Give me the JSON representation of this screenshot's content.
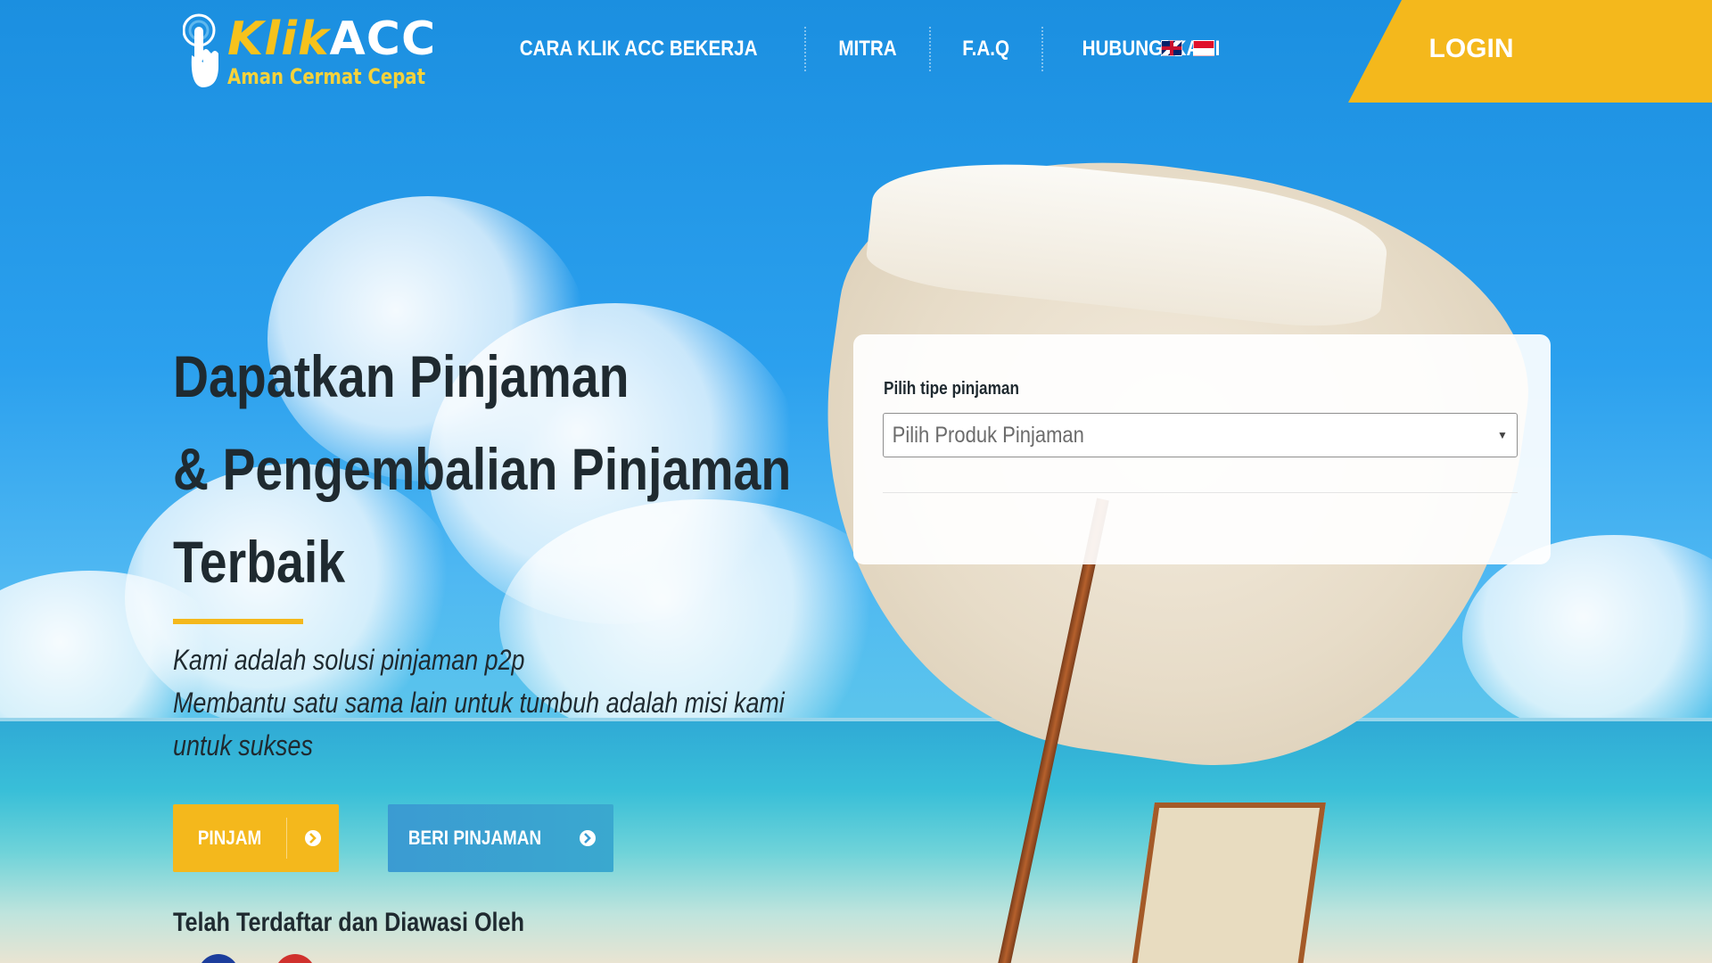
{
  "header": {
    "logo": {
      "title_part1": "Klik",
      "title_part2": "ACC",
      "tagline": "Aman Cermat Cepat"
    },
    "nav": [
      {
        "label": "CARA KLIK ACC BEKERJA"
      },
      {
        "label": "MITRA"
      },
      {
        "label": "F.A.Q"
      },
      {
        "label": "HUBUNGI KAMI"
      }
    ],
    "languages": [
      "english-flag-icon",
      "indonesia-flag-icon"
    ],
    "login_label": "LOGIN"
  },
  "hero": {
    "title_lines": [
      "Dapatkan Pinjaman",
      "& Pengembalian Pinjaman",
      "Terbaik"
    ],
    "subtitle_lines": [
      "Kami adalah solusi pinjaman p2p",
      "Membantu satu sama lain untuk tumbuh adalah misi kami",
      "untuk sukses"
    ],
    "buttons": {
      "pinjam": "PINJAM",
      "beri_pinjaman": "BERI PINJAMAN"
    },
    "registered_text": "Telah Terdaftar dan Diawasi Oleh"
  },
  "loan_form": {
    "label": "Pilih tipe pinjaman",
    "select_value": "Pilih Produk Pinjaman"
  },
  "colors": {
    "accent_yellow": "#f4b81c",
    "button_blue": "#3b9bd2",
    "text_dark": "#1f2a30"
  }
}
